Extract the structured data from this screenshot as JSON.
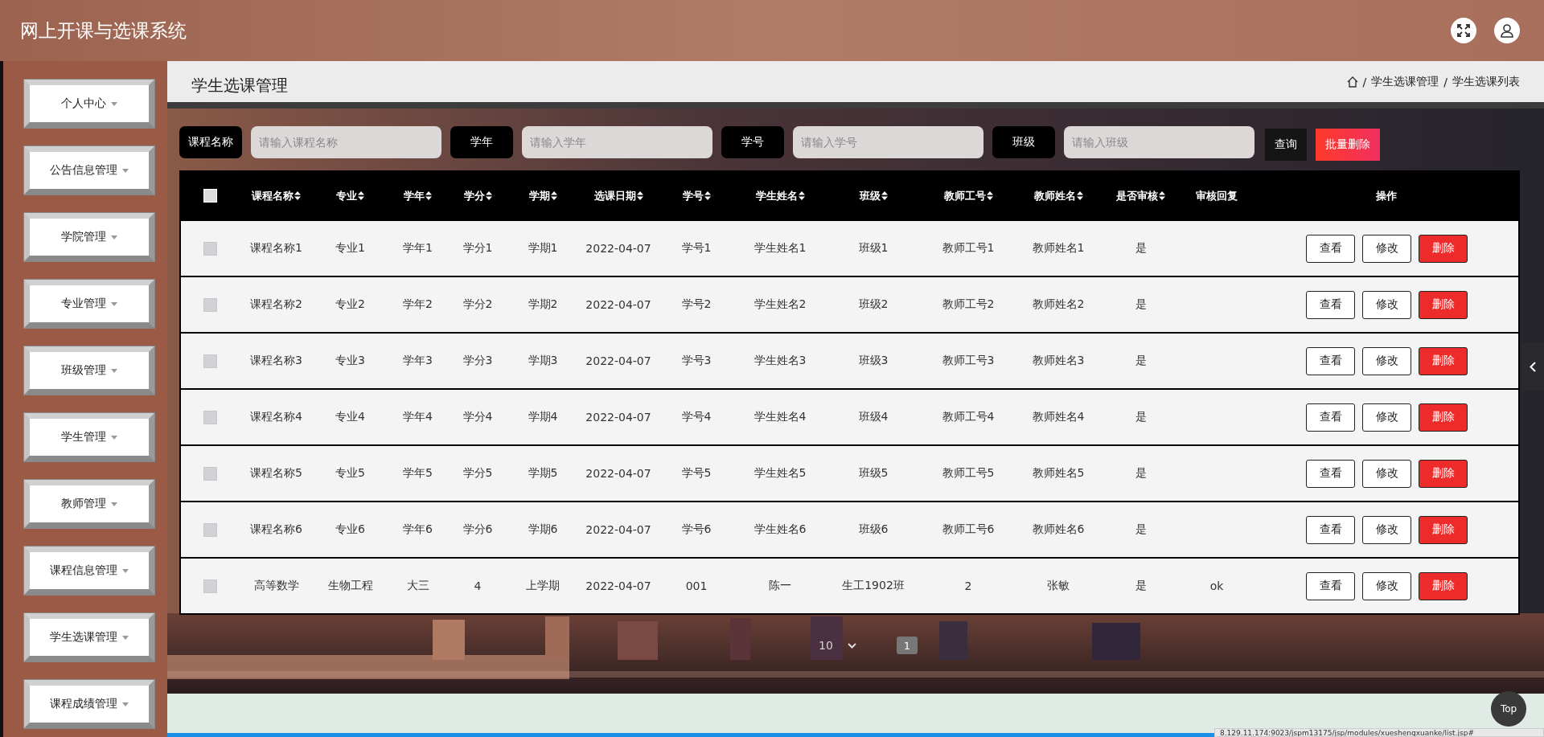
{
  "app": {
    "title": "网上开课与选课系统"
  },
  "sidebar": {
    "items": [
      {
        "label": "个人中心"
      },
      {
        "label": "公告信息管理"
      },
      {
        "label": "学院管理"
      },
      {
        "label": "专业管理"
      },
      {
        "label": "班级管理"
      },
      {
        "label": "学生管理"
      },
      {
        "label": "教师管理"
      },
      {
        "label": "课程信息管理"
      },
      {
        "label": "学生选课管理"
      },
      {
        "label": "课程成绩管理"
      }
    ]
  },
  "page": {
    "title": "学生选课管理",
    "breadcrumb": [
      {
        "separator": "/",
        "label": "学生选课管理"
      },
      {
        "separator": "/",
        "label": "学生选课列表"
      }
    ]
  },
  "search": {
    "fields": [
      {
        "label": "课程名称",
        "placeholder": "请输入课程名称"
      },
      {
        "label": "学年",
        "placeholder": "请输入学年"
      },
      {
        "label": "学号",
        "placeholder": "请输入学号"
      },
      {
        "label": "班级",
        "placeholder": "请输入班级"
      }
    ],
    "buttons": [
      {
        "label": "查询",
        "kind": "query"
      },
      {
        "label": "批量删除",
        "kind": "danger"
      }
    ]
  },
  "table": {
    "all_checked": false,
    "columns": [
      {
        "label": "课程名称",
        "sortable": true
      },
      {
        "label": "专业",
        "sortable": true
      },
      {
        "label": "学年",
        "sortable": true
      },
      {
        "label": "学分",
        "sortable": true
      },
      {
        "label": "学期",
        "sortable": true
      },
      {
        "label": "选课日期",
        "sortable": true
      },
      {
        "label": "学号",
        "sortable": true
      },
      {
        "label": "学生姓名",
        "sortable": true
      },
      {
        "label": "班级",
        "sortable": true
      },
      {
        "label": "教师工号",
        "sortable": true
      },
      {
        "label": "教师姓名",
        "sortable": true
      },
      {
        "label": "是否审核",
        "sortable": true
      },
      {
        "label": "审核回复",
        "sortable": false
      },
      {
        "label": "操作",
        "sortable": false
      }
    ],
    "rows": [
      {
        "checked": false,
        "cells": [
          "课程名称1",
          "专业1",
          "学年1",
          "学分1",
          "学期1",
          "2022-04-07",
          "学号1",
          "学生姓名1",
          "班级1",
          "教师工号1",
          "教师姓名1",
          "是",
          ""
        ],
        "actions": [
          {
            "label": "查看",
            "kind": "plain"
          },
          {
            "label": "修改",
            "kind": "plain"
          },
          {
            "label": "删除",
            "kind": "danger"
          }
        ]
      },
      {
        "checked": false,
        "cells": [
          "课程名称2",
          "专业2",
          "学年2",
          "学分2",
          "学期2",
          "2022-04-07",
          "学号2",
          "学生姓名2",
          "班级2",
          "教师工号2",
          "教师姓名2",
          "是",
          ""
        ],
        "actions": [
          {
            "label": "查看",
            "kind": "plain"
          },
          {
            "label": "修改",
            "kind": "plain"
          },
          {
            "label": "删除",
            "kind": "danger"
          }
        ]
      },
      {
        "checked": false,
        "cells": [
          "课程名称3",
          "专业3",
          "学年3",
          "学分3",
          "学期3",
          "2022-04-07",
          "学号3",
          "学生姓名3",
          "班级3",
          "教师工号3",
          "教师姓名3",
          "是",
          ""
        ],
        "actions": [
          {
            "label": "查看",
            "kind": "plain"
          },
          {
            "label": "修改",
            "kind": "plain"
          },
          {
            "label": "删除",
            "kind": "danger"
          }
        ]
      },
      {
        "checked": false,
        "cells": [
          "课程名称4",
          "专业4",
          "学年4",
          "学分4",
          "学期4",
          "2022-04-07",
          "学号4",
          "学生姓名4",
          "班级4",
          "教师工号4",
          "教师姓名4",
          "是",
          ""
        ],
        "actions": [
          {
            "label": "查看",
            "kind": "plain"
          },
          {
            "label": "修改",
            "kind": "plain"
          },
          {
            "label": "删除",
            "kind": "danger"
          }
        ]
      },
      {
        "checked": false,
        "cells": [
          "课程名称5",
          "专业5",
          "学年5",
          "学分5",
          "学期5",
          "2022-04-07",
          "学号5",
          "学生姓名5",
          "班级5",
          "教师工号5",
          "教师姓名5",
          "是",
          ""
        ],
        "actions": [
          {
            "label": "查看",
            "kind": "plain"
          },
          {
            "label": "修改",
            "kind": "plain"
          },
          {
            "label": "删除",
            "kind": "danger"
          }
        ]
      },
      {
        "checked": false,
        "cells": [
          "课程名称6",
          "专业6",
          "学年6",
          "学分6",
          "学期6",
          "2022-04-07",
          "学号6",
          "学生姓名6",
          "班级6",
          "教师工号6",
          "教师姓名6",
          "是",
          ""
        ],
        "actions": [
          {
            "label": "查看",
            "kind": "plain"
          },
          {
            "label": "修改",
            "kind": "plain"
          },
          {
            "label": "删除",
            "kind": "danger"
          }
        ]
      },
      {
        "checked": false,
        "cells": [
          "高等数学",
          "生物工程",
          "大三",
          "4",
          "上学期",
          "2022-04-07",
          "001",
          "陈一",
          "生工1902班",
          "2",
          "张敏",
          "是",
          "ok"
        ],
        "actions": [
          {
            "label": "查看",
            "kind": "plain"
          },
          {
            "label": "修改",
            "kind": "plain"
          },
          {
            "label": "删除",
            "kind": "danger"
          }
        ]
      }
    ]
  },
  "pagination": {
    "page_size": "10",
    "pages": [
      {
        "label": "1",
        "selected": true
      }
    ]
  },
  "top_button": "Top",
  "status_url": "8.129.11.174:9023/jspm13175/jsp/modules/xueshengxuanke/list.jsp#"
}
